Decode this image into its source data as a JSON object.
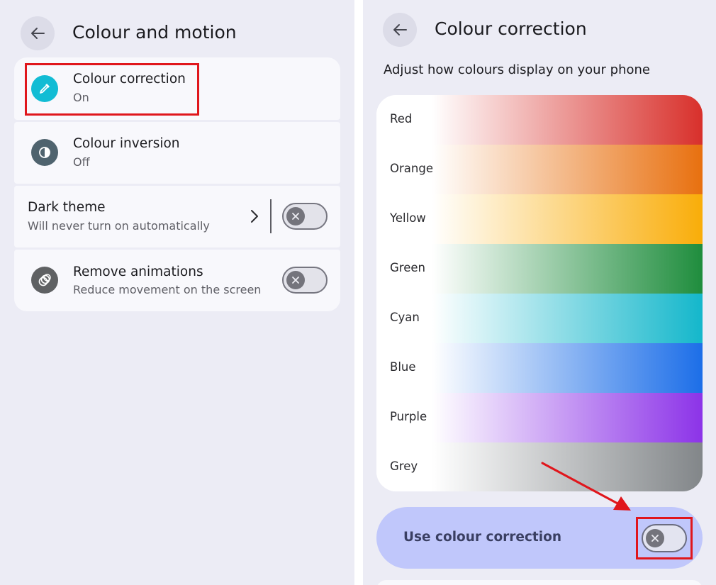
{
  "colour_motion": {
    "title": "Colour and motion",
    "items": [
      {
        "title": "Colour correction",
        "subtitle": "On",
        "icon": "eyedropper-icon"
      },
      {
        "title": "Colour inversion",
        "subtitle": "Off",
        "icon": "half-circle-icon"
      },
      {
        "title": "Dark theme",
        "subtitle": "Will never turn on automatically",
        "icon": "chevron-right-icon",
        "toggle": false
      },
      {
        "title": "Remove animations",
        "subtitle": "Reduce movement on the screen",
        "icon": "rings-icon",
        "toggle": false
      }
    ]
  },
  "colour_correction": {
    "title": "Colour correction",
    "subtitle": "Adjust how colours display on your phone",
    "swatches": [
      {
        "label": "Red",
        "color": "#d8302b"
      },
      {
        "label": "Orange",
        "color": "#e8700f"
      },
      {
        "label": "Yellow",
        "color": "#f9ad09"
      },
      {
        "label": "Green",
        "color": "#1f8d3d"
      },
      {
        "label": "Cyan",
        "color": "#14b7cb"
      },
      {
        "label": "Blue",
        "color": "#1c6ee8"
      },
      {
        "label": "Purple",
        "color": "#8c33e8"
      },
      {
        "label": "Grey",
        "color": "#828689"
      }
    ],
    "use_toggle": {
      "label": "Use colour correction",
      "enabled": false
    }
  },
  "colors": {
    "accent": "#12bcd4",
    "highlight": "#e0161c",
    "panel": "#ececf5",
    "use_bar": "#c0c7fb"
  }
}
